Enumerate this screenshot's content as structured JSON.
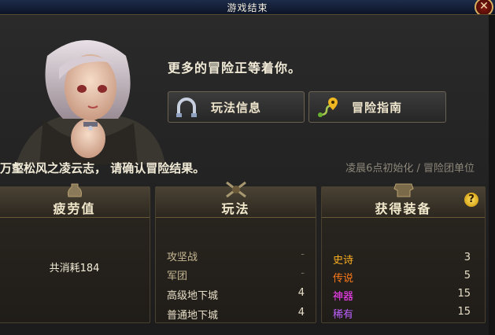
{
  "window": {
    "title": "游戏结束",
    "close_icon": "close-icon"
  },
  "header": {
    "headline": "更多的冒险正等着你。",
    "buttons": [
      {
        "label": "玩法信息",
        "icon": "horseshoe-magnet-icon"
      },
      {
        "label": "冒险指南",
        "icon": "map-route-pin-icon"
      }
    ]
  },
  "confirm_text": "万壑松风之凌云志， 请确认冒险结果。",
  "reset_note": "凌晨6点初始化 / 冒险团单位",
  "panels": {
    "fatigue": {
      "title": "疲劳值",
      "text": "共消耗184"
    },
    "gameplay": {
      "title": "玩法",
      "rows": [
        {
          "label": "攻坚战",
          "value": "-"
        },
        {
          "label": "军团",
          "value": "-"
        },
        {
          "label": "高级地下城",
          "value": "4"
        },
        {
          "label": "普通地下城",
          "value": "4"
        }
      ]
    },
    "equipment": {
      "title": "获得装备",
      "help_label": "?",
      "rows": [
        {
          "label": "史诗",
          "value": "3",
          "color": "#ffb020"
        },
        {
          "label": "传说",
          "value": "5",
          "color": "#ff7a18"
        },
        {
          "label": "神器",
          "value": "15",
          "color": "#ff40ff"
        },
        {
          "label": "稀有",
          "value": "15",
          "color": "#c060ff"
        }
      ]
    }
  },
  "colors": {
    "accent_gold": "#d8b060",
    "frame_bg": "#1c1c1c"
  }
}
